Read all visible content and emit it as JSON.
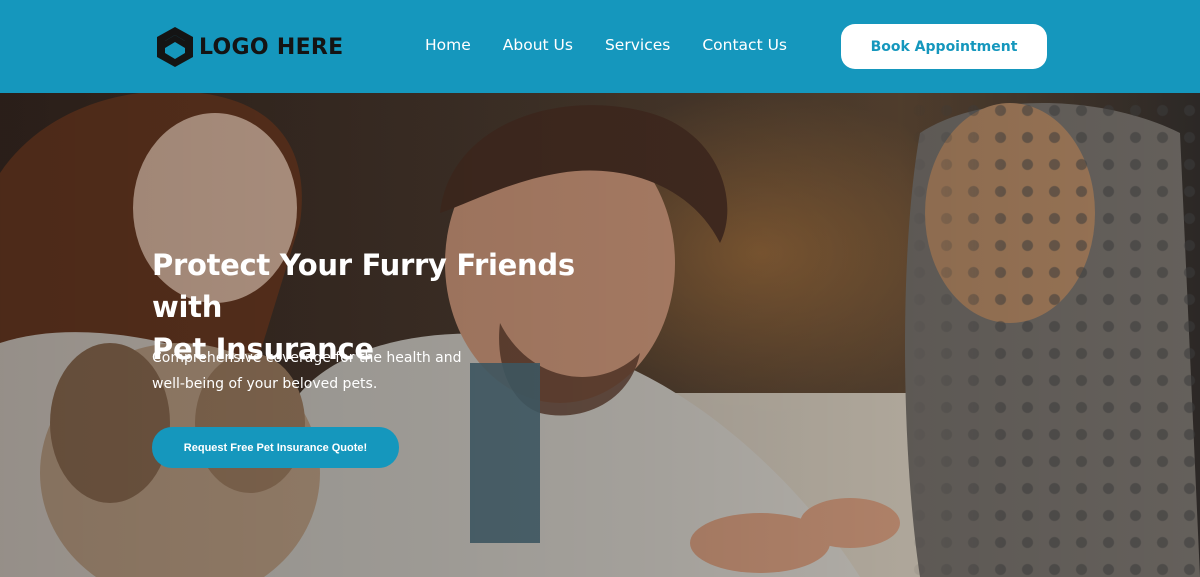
{
  "header": {
    "logo_text": "LOGO HERE",
    "nav": [
      "Home",
      "About Us",
      "Services",
      "Contact Us"
    ],
    "book_button": "Book Appointment"
  },
  "hero": {
    "title_line1": "Protect Your Furry Friends with",
    "title_line2": "Pet Insurance",
    "subtitle_line1": "Comprehensive coverage for the health and",
    "subtitle_line2": "well-being of your beloved pets.",
    "cta_button": "Request Free Pet Insurance Quote!"
  },
  "colors": {
    "brand": "#1597bd",
    "button_bg": "#ffffff",
    "text_light": "#ffffff"
  }
}
